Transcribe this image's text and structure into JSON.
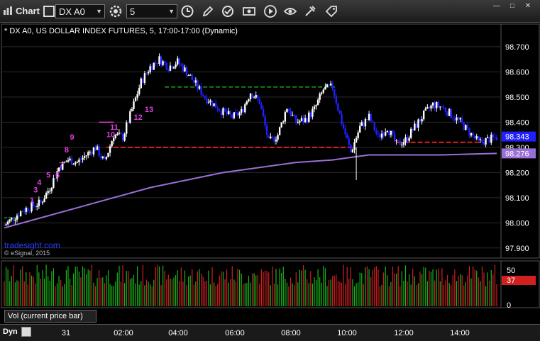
{
  "toolbar": {
    "chart_label": "Chart",
    "symbol_value": "DX A0",
    "interval_value": "5",
    "icons": [
      "chart-icon",
      "settings-gear-icon",
      "clock-icon",
      "pencil-icon",
      "refresh-icon",
      "dollar-icon",
      "play-icon",
      "eye-icon",
      "tools-icon",
      "tag-icon"
    ]
  },
  "window_controls": {
    "minimize": "—",
    "maximize": "□",
    "close": "✕"
  },
  "chart_title": "* DX A0, US DOLLAR INDEX FUTURES, 5, 17:00-17:00 (Dynamic)",
  "watermark": {
    "brand": "tradesight.com",
    "copyright": "© eSignal, 2015"
  },
  "volume_panel": {
    "label": "Vol (current price bar)",
    "axis_labels": [
      "50",
      "0"
    ],
    "current_value": "37"
  },
  "bottom_bar": {
    "dyn_label": "Dyn"
  },
  "colors": {
    "up_candle": "#ffffff",
    "down_candle": "#1f1fff",
    "moving_average": "#9a6fd6",
    "resistance_line": "#1db31d",
    "support_line": "#e02020",
    "count_labels": "#e040e0",
    "current_price_tag": "#1f1fff",
    "ma_price_tag": "#9a6fd6",
    "volume_up": "#1db31d",
    "volume_down": "#d22020"
  },
  "chart_data": {
    "type": "candlestick",
    "price_axis": {
      "ticks": [
        "98.700",
        "98.600",
        "98.500",
        "98.400",
        "98.300",
        "98.200",
        "98.100",
        "98.000",
        "97.900"
      ],
      "ylim": [
        97.86,
        98.79
      ]
    },
    "time_axis": [
      "31",
      "02:00",
      "04:00",
      "06:00",
      "08:00",
      "10:00",
      "12:00",
      "14:00"
    ],
    "current_price": "98.343",
    "ma_price": "98.276",
    "support_price": "98.300",
    "count_labels": [
      "1",
      "3",
      "4",
      "5",
      "6",
      "7",
      "8",
      "9",
      "10",
      "11",
      "12",
      "13"
    ],
    "close_path": [
      [
        0,
        97.99
      ],
      [
        10,
        98.05
      ],
      [
        20,
        98.08
      ],
      [
        25,
        98.14
      ],
      [
        30,
        98.22
      ],
      [
        35,
        98.25
      ],
      [
        40,
        98.24
      ],
      [
        45,
        98.27
      ],
      [
        50,
        98.3
      ],
      [
        55,
        98.24
      ],
      [
        60,
        98.35
      ],
      [
        65,
        98.34
      ],
      [
        70,
        98.45
      ],
      [
        75,
        98.56
      ],
      [
        80,
        98.62
      ],
      [
        85,
        98.65
      ],
      [
        90,
        98.62
      ],
      [
        95,
        98.64
      ],
      [
        100,
        98.6
      ],
      [
        105,
        98.55
      ],
      [
        110,
        98.5
      ],
      [
        115,
        98.47
      ],
      [
        120,
        98.44
      ],
      [
        125,
        98.42
      ],
      [
        130,
        98.44
      ],
      [
        135,
        98.52
      ],
      [
        140,
        98.48
      ],
      [
        145,
        98.32
      ],
      [
        150,
        98.35
      ],
      [
        155,
        98.46
      ],
      [
        160,
        98.4
      ],
      [
        165,
        98.41
      ],
      [
        170,
        98.45
      ],
      [
        175,
        98.53
      ],
      [
        180,
        98.54
      ],
      [
        185,
        98.4
      ],
      [
        190,
        98.28
      ],
      [
        195,
        98.38
      ],
      [
        200,
        98.42
      ],
      [
        205,
        98.34
      ],
      [
        210,
        98.38
      ],
      [
        215,
        98.31
      ],
      [
        220,
        98.33
      ],
      [
        225,
        98.38
      ],
      [
        230,
        98.43
      ],
      [
        235,
        98.47
      ],
      [
        240,
        98.46
      ],
      [
        245,
        98.43
      ],
      [
        250,
        98.4
      ],
      [
        255,
        98.36
      ],
      [
        260,
        98.32
      ],
      [
        265,
        98.33
      ],
      [
        270,
        98.34
      ]
    ],
    "ma_path": [
      [
        0,
        97.98
      ],
      [
        20,
        98.02
      ],
      [
        40,
        98.06
      ],
      [
        60,
        98.1
      ],
      [
        80,
        98.14
      ],
      [
        100,
        98.17
      ],
      [
        120,
        98.2
      ],
      [
        140,
        98.22
      ],
      [
        160,
        98.24
      ],
      [
        180,
        98.25
      ],
      [
        200,
        98.27
      ],
      [
        220,
        98.27
      ],
      [
        240,
        98.27
      ],
      [
        270,
        98.276
      ]
    ]
  }
}
